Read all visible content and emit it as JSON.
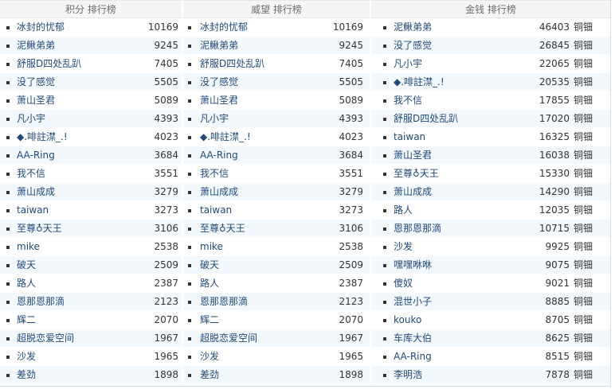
{
  "columns": [
    {
      "title": "积分  排行榜",
      "unit": "",
      "rows": [
        {
          "name": "冰封的忧郁",
          "value": "10169"
        },
        {
          "name": "泥鳅弟弟",
          "value": "9245"
        },
        {
          "name": "舒服D四处乱趴",
          "value": "7405"
        },
        {
          "name": "没了感觉",
          "value": "5505"
        },
        {
          "name": "萧山圣君",
          "value": "5089"
        },
        {
          "name": "凡小宇",
          "value": "4393"
        },
        {
          "name": "◆.啡註澿_.!",
          "value": "4023"
        },
        {
          "name": "AA-Ring",
          "value": "3684"
        },
        {
          "name": "我不信",
          "value": "3551"
        },
        {
          "name": "萧山成成",
          "value": "3279"
        },
        {
          "name": "taiwan",
          "value": "3273"
        },
        {
          "name": "至尊♁天王",
          "value": "3106"
        },
        {
          "name": "mike",
          "value": "2538"
        },
        {
          "name": "破天",
          "value": "2509"
        },
        {
          "name": "路人",
          "value": "2387"
        },
        {
          "name": "恩那恩那滴",
          "value": "2123"
        },
        {
          "name": "辉二",
          "value": "2070"
        },
        {
          "name": "超脱恋爱空间",
          "value": "1967"
        },
        {
          "name": "沙发",
          "value": "1965"
        },
        {
          "name": "差劲",
          "value": "1898"
        }
      ]
    },
    {
      "title": "威望  排行榜",
      "unit": "",
      "rows": [
        {
          "name": "冰封的忧郁",
          "value": "10169"
        },
        {
          "name": "泥鳅弟弟",
          "value": "9245"
        },
        {
          "name": "舒服D四处乱趴",
          "value": "7405"
        },
        {
          "name": "没了感觉",
          "value": "5505"
        },
        {
          "name": "萧山圣君",
          "value": "5089"
        },
        {
          "name": "凡小宇",
          "value": "4393"
        },
        {
          "name": "◆.啡註澿_.!",
          "value": "4023"
        },
        {
          "name": "AA-Ring",
          "value": "3684"
        },
        {
          "name": "我不信",
          "value": "3551"
        },
        {
          "name": "萧山成成",
          "value": "3279"
        },
        {
          "name": "taiwan",
          "value": "3273"
        },
        {
          "name": "至尊♁天王",
          "value": "3106"
        },
        {
          "name": "mike",
          "value": "2538"
        },
        {
          "name": "破天",
          "value": "2509"
        },
        {
          "name": "路人",
          "value": "2387"
        },
        {
          "name": "恩那恩那滴",
          "value": "2123"
        },
        {
          "name": "辉二",
          "value": "2070"
        },
        {
          "name": "超脱恋爱空间",
          "value": "1967"
        },
        {
          "name": "沙发",
          "value": "1965"
        },
        {
          "name": "差劲",
          "value": "1898"
        }
      ]
    },
    {
      "title": "金钱  排行榜",
      "unit": "铜钿",
      "rows": [
        {
          "name": "泥鳅弟弟",
          "value": "46403"
        },
        {
          "name": "没了感觉",
          "value": "26845"
        },
        {
          "name": "凡小宇",
          "value": "22065"
        },
        {
          "name": "◆.啡註澿_.!",
          "value": "20535"
        },
        {
          "name": "我不信",
          "value": "17855"
        },
        {
          "name": "舒服D四处乱趴",
          "value": "17020"
        },
        {
          "name": "taiwan",
          "value": "16325"
        },
        {
          "name": "萧山圣君",
          "value": "16038"
        },
        {
          "name": "至尊♁天王",
          "value": "15330"
        },
        {
          "name": "萧山成成",
          "value": "14290"
        },
        {
          "name": "路人",
          "value": "12035"
        },
        {
          "name": "恩那恩那滴",
          "value": "10715"
        },
        {
          "name": "沙发",
          "value": "9925"
        },
        {
          "name": "嘿嘿咻咻",
          "value": "9075"
        },
        {
          "name": "傻奴",
          "value": "9021"
        },
        {
          "name": "混世小子",
          "value": "8885"
        },
        {
          "name": "kouko",
          "value": "8705"
        },
        {
          "name": "车库大伯",
          "value": "8625"
        },
        {
          "name": "AA-Ring",
          "value": "8515"
        },
        {
          "name": "李明浩",
          "value": "7878"
        }
      ]
    }
  ]
}
